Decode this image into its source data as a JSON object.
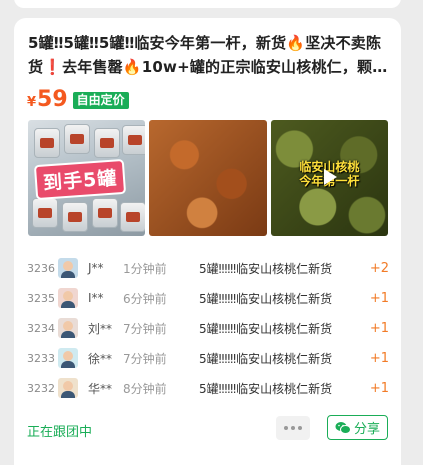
{
  "post": {
    "title": "5罐‼5罐‼5罐‼临安今年第一杆，新货🔥坚决不卖陈货❗去年售罄🔥10w+罐的正宗临安山核桃仁，颗粒饱满香脆可口",
    "price_symbol": "¥",
    "price": "59",
    "price_tag": "自由定价",
    "photos": [
      {
        "icon": "jars-photo",
        "overlay": "到手5罐"
      },
      {
        "icon": "walnut-kernels-photo"
      },
      {
        "icon": "green-walnuts-video",
        "overlay_line1": "临安山核桃",
        "overlay_line2": "今年第一杆"
      }
    ]
  },
  "orders": [
    {
      "no": "3236",
      "name": "J**",
      "time": "1分钟前",
      "product": "5罐‼‼‼临安山核桃仁新货",
      "qty": "+2",
      "avatar": "avatar-a"
    },
    {
      "no": "3235",
      "name": "I**",
      "time": "6分钟前",
      "product": "5罐‼‼‼临安山核桃仁新货",
      "qty": "+1",
      "avatar": "avatar-b"
    },
    {
      "no": "3234",
      "name": "刘**",
      "time": "7分钟前",
      "product": "5罐‼‼‼临安山核桃仁新货",
      "qty": "+1",
      "avatar": "avatar-c"
    },
    {
      "no": "3233",
      "name": "徐**",
      "time": "7分钟前",
      "product": "5罐‼‼‼临安山核桃仁新货",
      "qty": "+1",
      "avatar": "avatar-d"
    },
    {
      "no": "3232",
      "name": "华**",
      "time": "8分钟前",
      "product": "5罐‼‼‼临安山核桃仁新货",
      "qty": "+1",
      "avatar": "avatar-e"
    }
  ],
  "footer": {
    "status": "正在跟团中",
    "share_label": "分享"
  },
  "colors": {
    "accent_green": "#1aad57",
    "price_orange": "#f4591f",
    "qty_orange": "#f27b27"
  }
}
